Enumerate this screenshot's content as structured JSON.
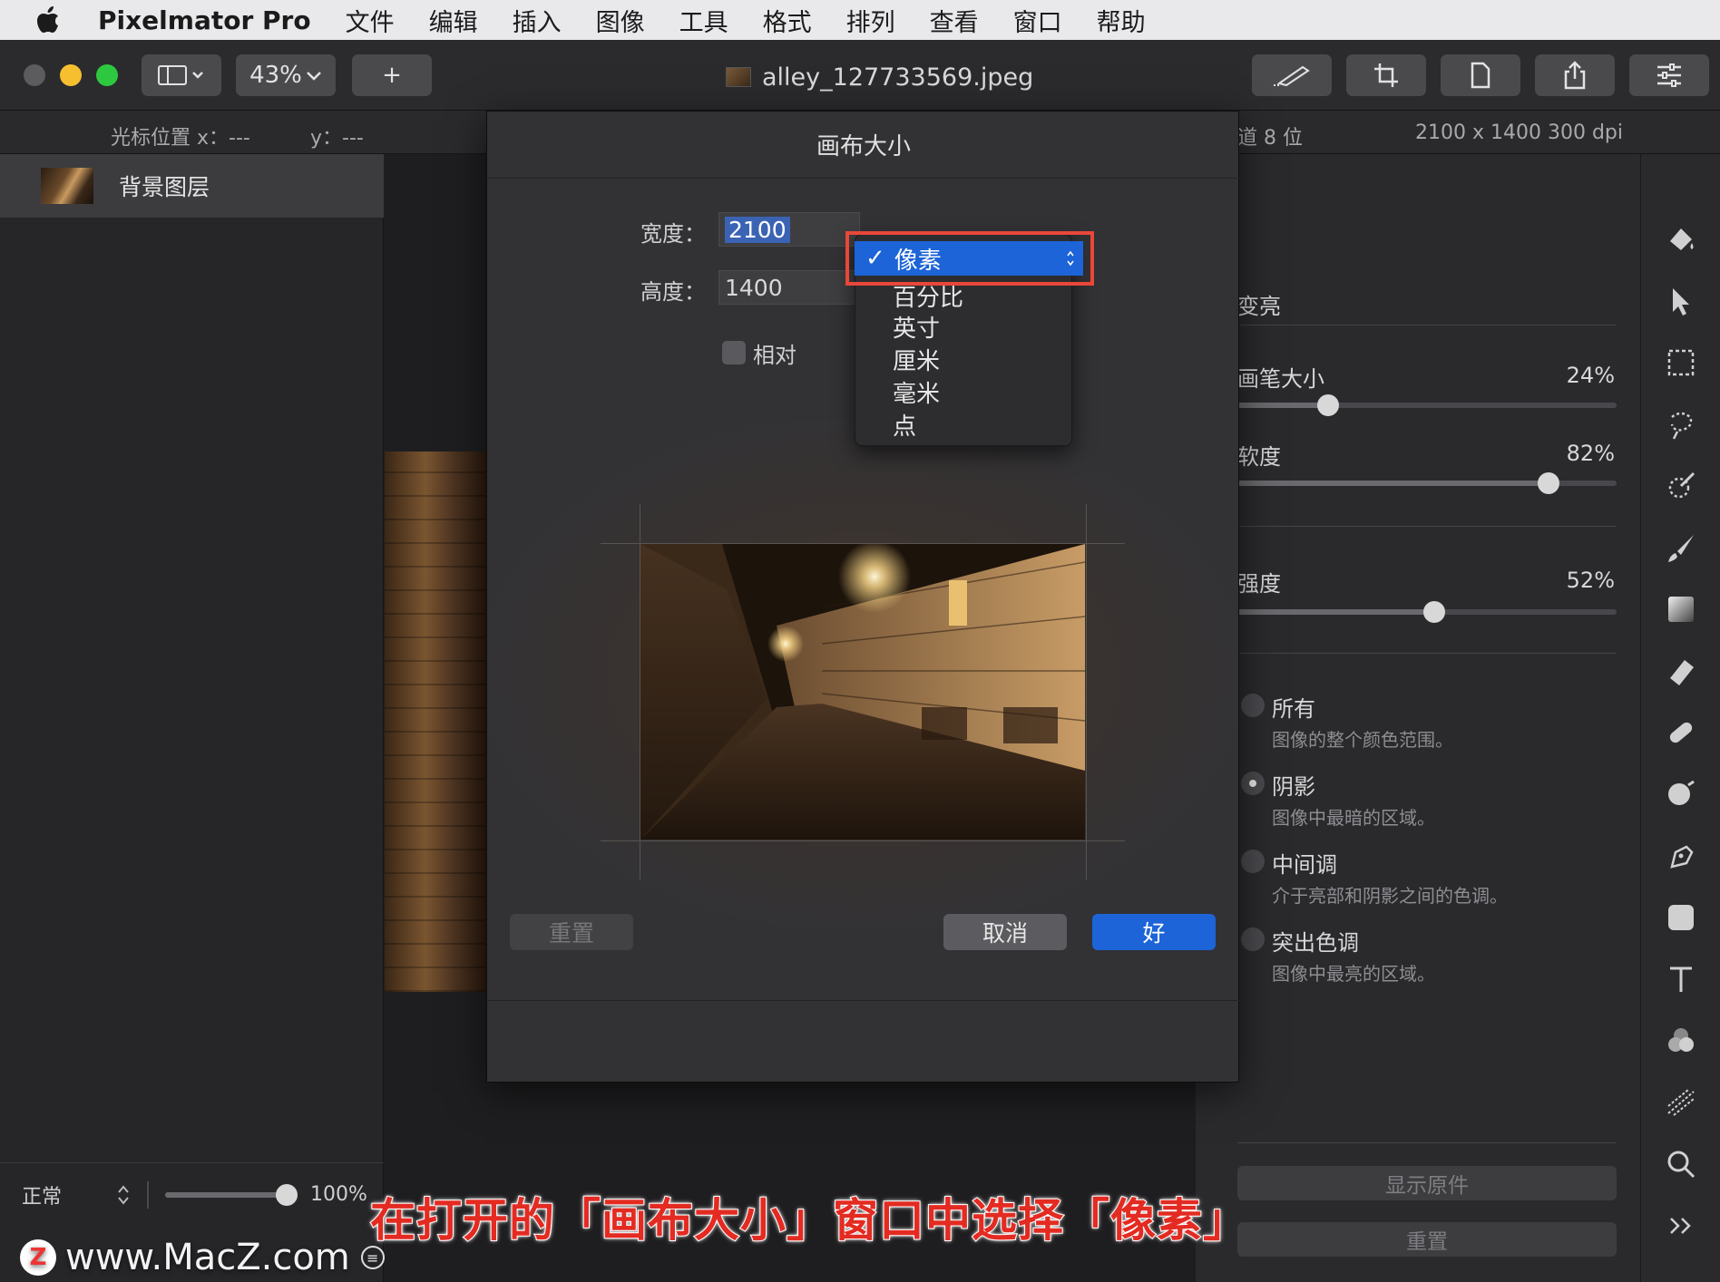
{
  "menubar": {
    "app_name": "Pixelmator Pro",
    "items": [
      "文件",
      "编辑",
      "插入",
      "图像",
      "工具",
      "格式",
      "排列",
      "查看",
      "窗口",
      "帮助"
    ]
  },
  "toolbar": {
    "zoom": "43%",
    "add_label": "+",
    "document_title": "alley_127733569.jpeg"
  },
  "infobar": {
    "cursor_x_label": "光标位置 x：---",
    "cursor_y_label": "y：---",
    "channel_info": "道 8 位",
    "image_info": "2100 x 1400 300 dpi"
  },
  "layers": {
    "items": [
      {
        "label": "背景图层"
      }
    ],
    "blend_mode": "正常",
    "opacity": "100%",
    "opacity_fraction": 1.0
  },
  "dialog": {
    "title": "画布大小",
    "width_label": "宽度：",
    "width_value": "2100",
    "height_label": "高度：",
    "height_value": "1400",
    "relative_label": "相对",
    "reset_button": "重置",
    "cancel_button": "取消",
    "ok_button": "好"
  },
  "unit_dropdown": {
    "selected": "像素",
    "check": "✓",
    "options": [
      "像素",
      "百分比",
      "英寸",
      "厘米",
      "毫米",
      "点"
    ]
  },
  "right_panel": {
    "brighten_label": "变亮",
    "brush_size_label": "画笔大小",
    "brush_size_value": "24%",
    "brush_size_fraction": 0.24,
    "softness_label": "软度",
    "softness_value": "82%",
    "softness_fraction": 0.82,
    "strength_label": "强度",
    "strength_value": "52%",
    "strength_fraction": 0.52,
    "ranges": [
      {
        "title": "所有",
        "desc": "图像的整个颜色范围。",
        "selected": false
      },
      {
        "title": "阴影",
        "desc": "图像中最暗的区域。",
        "selected": true
      },
      {
        "title": "中间调",
        "desc": "介于亮部和阴影之间的色调。",
        "selected": false
      },
      {
        "title": "突出色调",
        "desc": "图像中最亮的区域。",
        "selected": false
      }
    ],
    "show_original_button": "显示原件",
    "reset_button": "重置"
  },
  "tools": [
    "paint-bucket-icon",
    "arrow-icon",
    "rect-select-icon",
    "lasso-icon",
    "magic-wand-icon",
    "brush-icon",
    "gradient-icon",
    "eraser-icon",
    "bandage-icon",
    "repair-icon",
    "pen-icon",
    "shape-icon",
    "text-icon",
    "color-adjust-icon",
    "distort-icon",
    "zoom-icon",
    "more-icon"
  ],
  "caption": "在打开的「画布大小」窗口中选择「像素」",
  "watermark": {
    "logo": "Z",
    "text": "www.MacZ.com"
  },
  "colors": {
    "accent": "#1c64d8",
    "highlight_box": "#e8473a",
    "caption": "#e32b22"
  }
}
